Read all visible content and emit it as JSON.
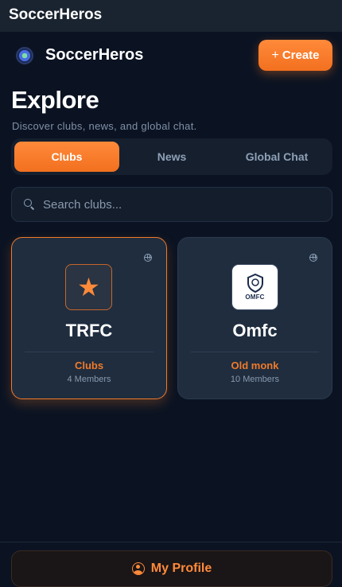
{
  "window": {
    "title": "SoccerHeros"
  },
  "header": {
    "brand": "SoccerHeros",
    "create_label": "Create"
  },
  "explore": {
    "title": "Explore",
    "subtitle": "Discover clubs, news, and global chat."
  },
  "tabs": [
    {
      "label": "Clubs",
      "active": true
    },
    {
      "label": "News",
      "active": false
    },
    {
      "label": "Global Chat",
      "active": false
    }
  ],
  "search": {
    "placeholder": "Search clubs..."
  },
  "clubs": [
    {
      "name": "TRFC",
      "type": "Clubs",
      "members": "4 Members",
      "icon": "star-icon",
      "selected": true
    },
    {
      "name": "Omfc",
      "type": "Old monk",
      "members": "10 Members",
      "icon": "club-crest-image",
      "crest_text": "OMFC",
      "selected": false
    }
  ],
  "footer": {
    "profile_label": "My Profile"
  },
  "colors": {
    "accent": "#f2701f",
    "background": "#0b1322",
    "card": "#1f2d3f"
  }
}
